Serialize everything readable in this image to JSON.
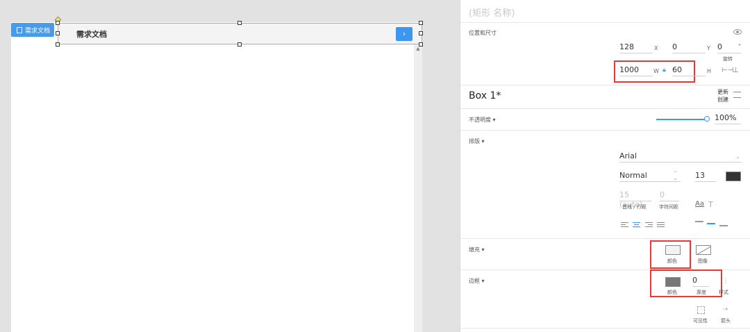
{
  "canvas": {
    "page_tag_label": "需求文档",
    "box_title": "需求文档",
    "box_button_glyph": "›",
    "scroll_up_glyph": "▲"
  },
  "inspector": {
    "shape_name_placeholder": "(矩形 名称)",
    "position_size_label": "位置和尺寸",
    "x_value": "128",
    "x_unit": "X",
    "y_value": "0",
    "y_unit": "Y",
    "rotation_value": "0",
    "rotation_unit": "°",
    "rotation_label": "旋转",
    "w_value": "1000",
    "w_unit": "W",
    "h_value": "60",
    "h_unit": "H",
    "box_name": "Box 1*",
    "update_label_1": "更新",
    "update_label_2": "创建",
    "opacity_label": "不透明度 ▾",
    "opacity_value": "100%",
    "typography_label": "排版 ▾",
    "font_family": "Arial",
    "font_weight": "Normal",
    "font_size": "13",
    "line_height_value": "15 (auto)",
    "line_height_label": "首线 / 行距",
    "letter_spacing_value": "0",
    "letter_spacing_label": "字符间距",
    "aa_glyph": "Aa",
    "t_glyph": "T",
    "fill_label": "填充 ▾",
    "fill_color_label": "颜色",
    "fill_image_label": "图像",
    "border_label": "边框 ▾",
    "border_color_label": "颜色",
    "border_thickness_value": "0",
    "border_thickness_label": "厚度",
    "border_style_label": "样式",
    "visibility_label": "可见性",
    "arrow_label": "箭头"
  },
  "colors": {
    "accent": "#3d96f0",
    "highlight_red": "#e53935",
    "selection_cyan": "#52d0d8",
    "font_color_swatch": "#333333",
    "border_color_swatch": "#777777",
    "fill_color_swatch": "#f3f3f3"
  },
  "icons": {
    "eye": "eye-icon",
    "lock": "lock-icon",
    "opacity_slider": "slider-icon",
    "page": "page-icon"
  }
}
